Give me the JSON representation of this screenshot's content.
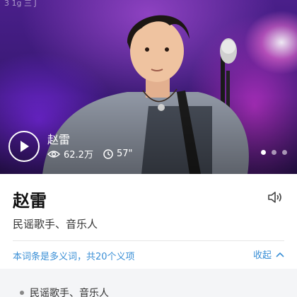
{
  "status_fragment": "3  1g 三 J",
  "video": {
    "title": "赵雷",
    "views": "62.2万",
    "duration": "57\"",
    "slide_count": 3,
    "active_slide": 0
  },
  "entry": {
    "title": "赵雷",
    "subtitle": "民谣歌手、音乐人"
  },
  "disambiguation": {
    "text": "本词条是多义词，共20个义项",
    "collapse_label": "收起"
  },
  "senses": [
    {
      "label": "民谣歌手、音乐人"
    }
  ],
  "colors": {
    "link_blue": "#3a8fd6",
    "stage_purple": "#4a1f8a"
  }
}
